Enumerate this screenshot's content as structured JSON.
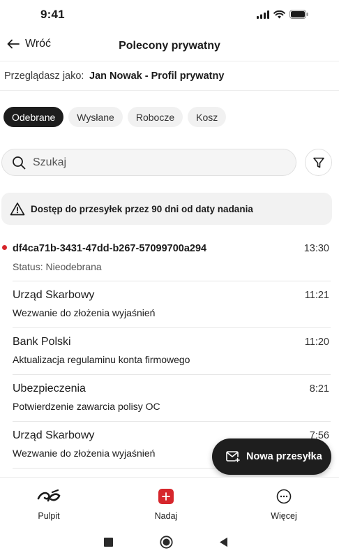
{
  "status_bar": {
    "time": "9:41"
  },
  "header": {
    "back_label": "Wróć",
    "title": "Polecony prywatny"
  },
  "viewing": {
    "label": "Przeglądasz jako:",
    "value": "Jan Nowak - Profil prywatny"
  },
  "tabs": [
    {
      "label": "Odebrane",
      "active": true
    },
    {
      "label": "Wysłane",
      "active": false
    },
    {
      "label": "Robocze",
      "active": false
    },
    {
      "label": "Kosz",
      "active": false
    }
  ],
  "search": {
    "placeholder": "Szukaj"
  },
  "banner": {
    "text": "Dostęp do przesyłek przez 90 dni od daty nadania",
    "icon": "warning-icon"
  },
  "messages": [
    {
      "title": "df4ca71b-3431-47dd-b267-57099700a294",
      "subtitle": "Status: Nieodebrana",
      "time": "13:30",
      "unread": true
    },
    {
      "title": "Urząd Skarbowy",
      "subtitle": "Wezwanie do złożenia wyjaśnień",
      "time": "11:21",
      "unread": false
    },
    {
      "title": "Bank Polski",
      "subtitle": "Aktualizacja regulaminu konta firmowego",
      "time": "11:20",
      "unread": false
    },
    {
      "title": "Ubezpieczenia",
      "subtitle": "Potwierdzenie zawarcia polisy OC",
      "time": "8:21",
      "unread": false
    },
    {
      "title": "Urząd Skarbowy",
      "subtitle": "Wezwanie do złożenia wyjaśnień",
      "time": "7:56",
      "unread": false
    }
  ],
  "fab": {
    "label": "Nowa przesyłka",
    "icon": "mail-plus-icon"
  },
  "bottom_nav": [
    {
      "label": "Pulpit",
      "icon": "poczta-logo-icon"
    },
    {
      "label": "Nadaj",
      "icon": "add-icon"
    },
    {
      "label": "Więcej",
      "icon": "more-icon"
    }
  ],
  "colors": {
    "accent": "#d6262c",
    "dark": "#1d1d1d"
  }
}
